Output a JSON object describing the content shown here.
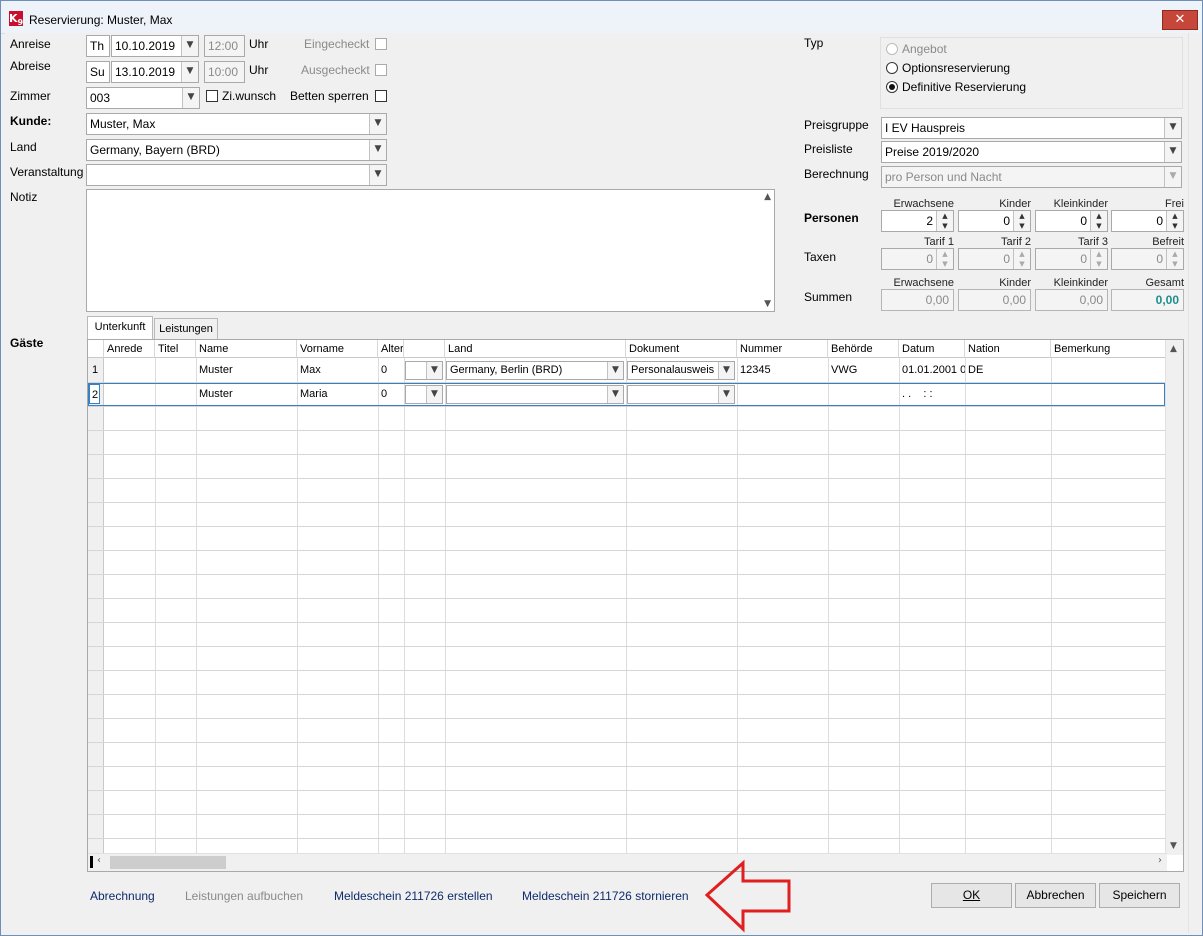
{
  "window": {
    "title": "Reservierung: Muster, Max",
    "app_icon": "K9-logo",
    "close_label": "✕"
  },
  "arrival": {
    "label": "Anreise",
    "weekday": "Th",
    "date": "10.10.2019",
    "time": "12:00",
    "time_unit": "Uhr",
    "checked_label": "Eingecheckt",
    "checked": false
  },
  "departure": {
    "label": "Abreise",
    "weekday": "Su",
    "date": "13.10.2019",
    "time": "10:00",
    "time_unit": "Uhr",
    "checked_label": "Ausgecheckt",
    "checked": false
  },
  "room": {
    "label": "Zimmer",
    "value": "003",
    "wish_label": "Zi.wunsch",
    "wish_checked": false,
    "lock_beds_label": "Betten sperren",
    "lock_beds_checked": false
  },
  "customer": {
    "label": "Kunde:",
    "value": "Muster, Max"
  },
  "country": {
    "label": "Land",
    "value": "Germany, Bayern (BRD)"
  },
  "event": {
    "label": "Veranstaltung",
    "value": ""
  },
  "note": {
    "label": "Notiz",
    "value": ""
  },
  "type": {
    "label": "Typ",
    "options": [
      "Angebot",
      "Optionsreservierung",
      "Definitive Reservierung"
    ],
    "selected": 2
  },
  "pricing": {
    "group_label": "Preisgruppe",
    "group_value": "I EV Hauspreis",
    "list_label": "Preisliste",
    "list_value": "Preise 2019/2020",
    "calc_label": "Berechnung",
    "calc_value": "pro Person und Nacht"
  },
  "persons": {
    "label": "Personen",
    "columns": [
      "Erwachsene",
      "Kinder",
      "Kleinkinder",
      "Frei"
    ],
    "values": [
      "2",
      "0",
      "0",
      "0"
    ]
  },
  "taxes": {
    "label": "Taxen",
    "columns": [
      "Tarif 1",
      "Tarif 2",
      "Tarif 3",
      "Befreit"
    ],
    "values": [
      "0",
      "0",
      "0",
      "0"
    ]
  },
  "sums": {
    "label": "Summen",
    "columns": [
      "Erwachsene",
      "Kinder",
      "Kleinkinder",
      "Gesamt"
    ],
    "values": [
      "0,00",
      "0,00",
      "0,00",
      "0,00"
    ]
  },
  "guests": {
    "label": "Gäste",
    "tabs": [
      "Unterkunft",
      "Leistungen"
    ],
    "columns": [
      "Anrede",
      "Titel",
      "Name",
      "Vorname",
      "Alter",
      "",
      "Land",
      "Dokument",
      "Nummer",
      "Behörde",
      "Datum",
      "Nation",
      "Bemerkung"
    ],
    "rows": [
      {
        "num": "1",
        "anrede": "",
        "titel": "",
        "name": "Muster",
        "vorname": "Max",
        "alter": "0",
        "land": "Germany, Berlin (BRD)",
        "dokument": "Personalausweis",
        "nummer": "12345",
        "behoerde": "VWG",
        "datum": "01.01.2001 0",
        "nation": "DE",
        "bemerkung": ""
      },
      {
        "num": "2",
        "anrede": "",
        "titel": "",
        "name": "Muster",
        "vorname": "Maria",
        "alter": "0",
        "land": "",
        "dokument": "",
        "nummer": "",
        "behoerde": "",
        "datum": ". .    : :",
        "nation": "",
        "bemerkung": ""
      }
    ]
  },
  "footer": {
    "billing": "Abrechnung",
    "book_services": "Leistungen aufbuchen",
    "create_form": "Meldeschein 211726 erstellen",
    "cancel_form": "Meldeschein 211726 stornieren",
    "ok": "OK",
    "cancel": "Abbrechen",
    "save": "Speichern"
  },
  "annotation": {
    "icon": "red-outline-arrow-left",
    "color": "#e02020"
  }
}
